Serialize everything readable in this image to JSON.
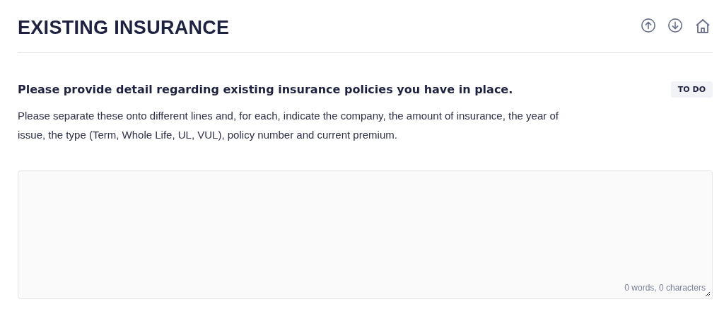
{
  "page": {
    "title": "EXISTING INSURANCE"
  },
  "question": {
    "title": "Please provide detail regarding existing insurance policies you have in place.",
    "status": "TO DO",
    "description": "Please separate these onto different lines and, for each, indicate the company, the amount of insurance, the year of issue, the type (Term, Whole Life, UL, VUL), policy number and current premium."
  },
  "answer": {
    "counter": "0 words, 0 characters"
  }
}
